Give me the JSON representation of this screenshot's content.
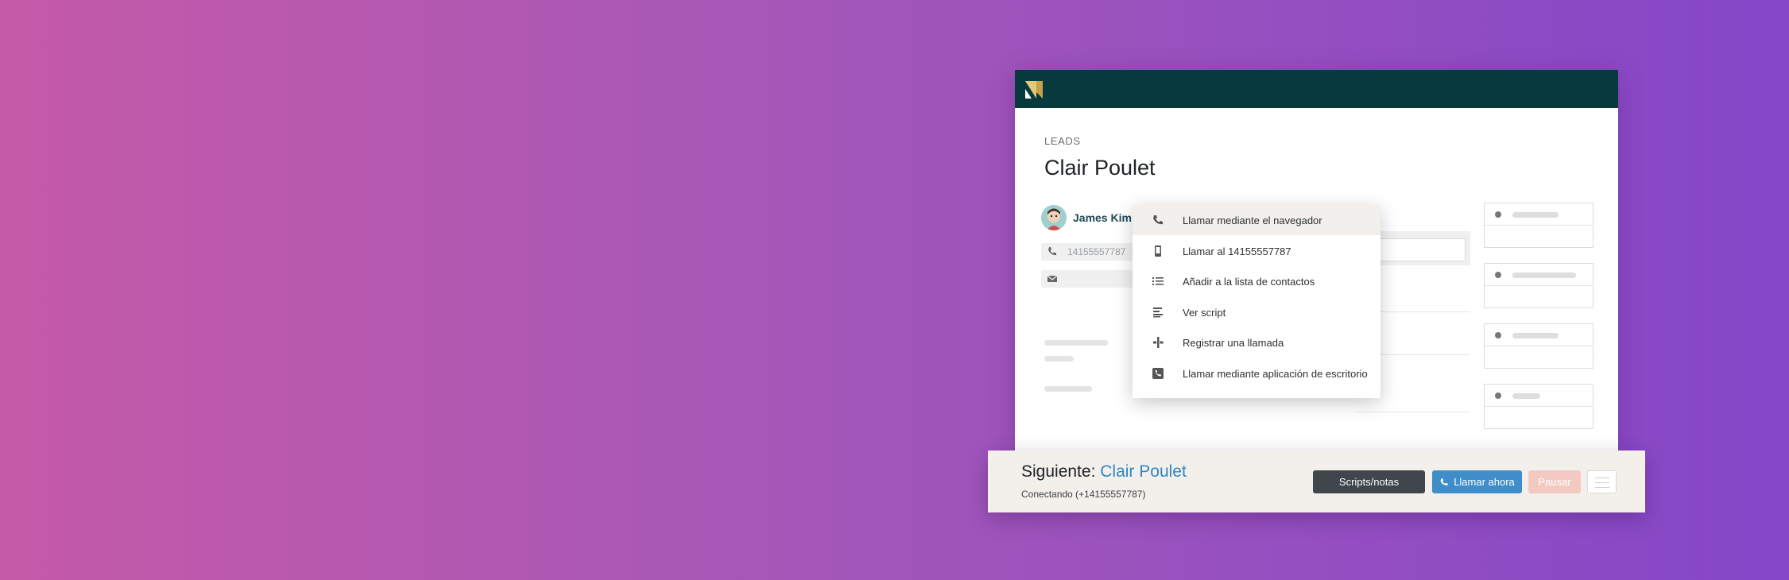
{
  "colors": {
    "topbar": "#063a3d",
    "accent": "#2e86c1",
    "call_button": "#3f8dc9",
    "pause_button": "#f4c9c1",
    "scripts_button": "#40464c"
  },
  "page": {
    "breadcrumb": "LEADS",
    "title": "Clair Poulet"
  },
  "lead": {
    "owner_name": "James Kim",
    "phone": "14155557787"
  },
  "call_menu": {
    "items": [
      {
        "label": "Llamar mediante el navegador",
        "icon": "phone-icon"
      },
      {
        "label": "Llamar al 14155557787",
        "icon": "mobile-phone-icon"
      },
      {
        "label": "Añadir a la lista de contactos",
        "icon": "list-icon"
      },
      {
        "label": "Ver script",
        "icon": "script-icon"
      },
      {
        "label": "Registrar una llamada",
        "icon": "log-call-icon"
      },
      {
        "label": "Llamar mediante aplicación de escritorio",
        "icon": "desktop-phone-icon"
      }
    ]
  },
  "dialer": {
    "next_label": "Siguiente:",
    "next_name": "Clair Poulet",
    "status": "Conectando (+14155557787)",
    "buttons": {
      "scripts": "Scripts/notas",
      "call": "Llamar ahora",
      "pause": "Pausar"
    }
  }
}
